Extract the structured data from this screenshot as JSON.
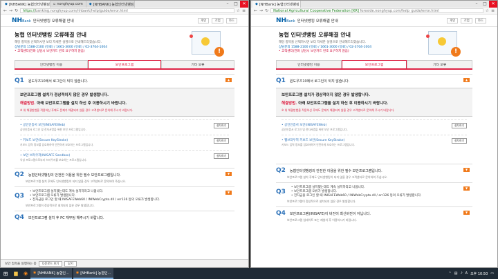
{
  "left_window": {
    "tabs": [
      {
        "label": "[NHBANK] 농협인터넷뱅킹",
        "active": true
      },
      {
        "label": "nonghyup.com",
        "active": false
      },
      {
        "label": "[NHBANK] 농협인터넷뱅킹",
        "active": false
      }
    ],
    "url_secure": "https://",
    "url": "banking.nonghyup.com/nhbank/help/guide/error.html",
    "page": {
      "logo_main": "NH",
      "logo_sub": "Bank",
      "title": "인터넷뱅킹 오류해결 안내",
      "links": [
        "개인",
        "기업",
        "카드"
      ],
      "hero_title": "농협 인터넷뱅킹 오류해결 안내",
      "hero_sub1": "해당 항목을 선택하시면 보다 자세한 설명으로 안내해드리겠습니다.",
      "hero_tel": "상담문의 1588-2100 (유료) / 1661-3000 (유료) / 02-3704-1004",
      "hero_notice": "• 고객센터(전화 상담시 보안카드 번호 요구하지 않음)",
      "tabs": [
        "인터넷뱅킹 이용",
        "보안프로그램",
        "기타 오류"
      ],
      "active_tab": 1,
      "q1_num": "Q1",
      "q1_text": "윈도우즈10에서 로그인이 되지 않습니다.",
      "box_head": "보안프로그램 설치가 정상적이지 않은 경우 발생합니다.",
      "sol_label": "해결방법.",
      "sol_text": "아래 보안프로그램을 설치 하신 후 이용하시기 바랍니다.",
      "note": "※ 위 해결방법을 적용하신 후에도 문제가 해결되지 않을 경우 고객센터로 문의해 주시기 바랍니다.",
      "progs": [
        {
          "name": "• 공인인증서 보안(INISAFEWeb)",
          "desc": "공인인증서 로그인 및 전자서명을 위한 보안 프로그램입니다.",
          "btn": "설치하기"
        },
        {
          "name": "• 키보드 보안(Secure KeyStroke)",
          "desc": "키보드 입력 정보를 암호화하여 안전하게 보호하는 프로그램입니다.",
          "btn": "설치하기"
        },
        {
          "name": "• 보안 브라우저(INISAFE Sandbox)",
          "desc": "악성 프로그램으로부터 브라우저를 보호하는 프로그램입니다.",
          "btn": "설치하기"
        }
      ],
      "q2_num": "Q2",
      "q2_text": "농협인터넷뱅킹의 안전한 이용을 위한 필수 보안프로그램입니다.",
      "q2_desc": "보안프로그램 설치 후에도 인터넷뱅킹이 되지 않을 경우 고객센터로 문의하여 주십시오.",
      "q3_num": "Q3",
      "q3_bullets": [
        "보안프로그램 설치했는데도 계속 설치하라고 나옵니다.",
        "보안프로그램 오류가 발생합니다.",
        "전자금융 로그인 할 때 INISAFEWeb60 / INIWebCrypto.dll / err126 등의 오류가 발생합니다."
      ],
      "q3_desc": "보안프로그램이 정상적으로 설치되지 않은 경우 발생합니다.",
      "q4_num": "Q4",
      "q4_text": "보안프로그램 설치 후 PC 재부팅 해주시기 바랍니다."
    },
    "download_bar": {
      "text": "보안 접속을 실행하는 중",
      "buttons": [
        "다운로드 보기",
        "닫기"
      ]
    }
  },
  "right_window": {
    "tabs": [
      {
        "label": "[NHBank] 농협인터넷뱅킹",
        "active": true
      }
    ],
    "url_secure": "National Agricultural Cooperative Federation [KR]",
    "url": "foreside.nonghyup.com/help_guide/error.html",
    "page": {
      "logo_main": "NH",
      "logo_sub": "Bank",
      "title": "인터넷뱅킹 오류해결 안내",
      "links": [
        "개인",
        "기업",
        "카드"
      ],
      "hero_title": "농협 인터넷뱅킹 오류해결 안내",
      "hero_sub1": "해당 항목을 선택하시면 보다 자세한 설명으로 안내해드리겠습니다.",
      "hero_tel": "상담문의 1588-2100 (유료) / 1661-3000 (유료) / 02-3704-1004",
      "hero_notice": "• 고객센터(전화 상담시 보안카드 번호 요구하지 않음)",
      "tabs": [
        "인터넷뱅킹 이용",
        "보안프로그램",
        "기타 오류"
      ],
      "active_tab": 1,
      "q1_num": "Q1",
      "q1_text": "윈도우즈10에서 로그인이 되지 않습니다.",
      "box_head": "보안프로그램 설치가 정상적이지 않은 경우 발생합니다.",
      "sol_label": "해결방법.",
      "sol_text": "아래 보안프로그램을 설치 하신 후 이용하시기 바랍니다.",
      "note": "※ 위 해결방법을 적용하신 후에도 문제가 해결되지 않을 경우 고객센터로 문의해 주시기 바랍니다.",
      "progs": [
        {
          "name": "• 공인인증서 보안(INISAFEWeb)",
          "desc": "공인인증서 로그인 및 전자서명을 위한 보안 프로그램입니다.",
          "btn": "설치하기"
        },
        {
          "name": "• 웹브라우저 키보드 보안(Secure KeyStroke)",
          "desc": "키보드 입력 정보를 암호화하여 안전하게 보호하는 프로그램입니다.",
          "btn": "설치하기"
        }
      ],
      "q2_num": "Q2",
      "q2_text": "농협인터넷뱅킹의 안전한 이용을 위한 필수 보안프로그램입니다.",
      "q2_desc": "보안프로그램 설치 후에도 인터넷뱅킹이 되지 않을 경우 고객센터로 문의하여 주십시오.",
      "q3_num": "Q3",
      "q3_bullets": [
        "보안프로그램 설치했는데도 계속 설치하라고 나옵니다.",
        "보안프로그램 오류가 발생합니다.",
        "전자금융 로그인 할 때 INISAFEWeb60 / INIWebCrypto.dll / err126 등의 오류가 발생합니다."
      ],
      "q3_desc": "보안프로그램이 정상적으로 설치되지 않은 경우 발생합니다.",
      "q4_num": "Q4",
      "q4_text": "보안프로그램(INISAFE)이 버전이 최신버전이 아닙니다.",
      "q4_desc": "보안프로그램 업데이트 또는 재설치 후 이용하시기 바랍니다."
    }
  },
  "taskbar": {
    "items": [
      "[NHBANK] 농협인...",
      "[NHBank] 농협인..."
    ],
    "tray_lang": "A",
    "tray_time": "오후 10:50"
  },
  "colors": {
    "accent": "#d2224a",
    "brand": "#0060a8",
    "orange": "#f07a1b"
  }
}
